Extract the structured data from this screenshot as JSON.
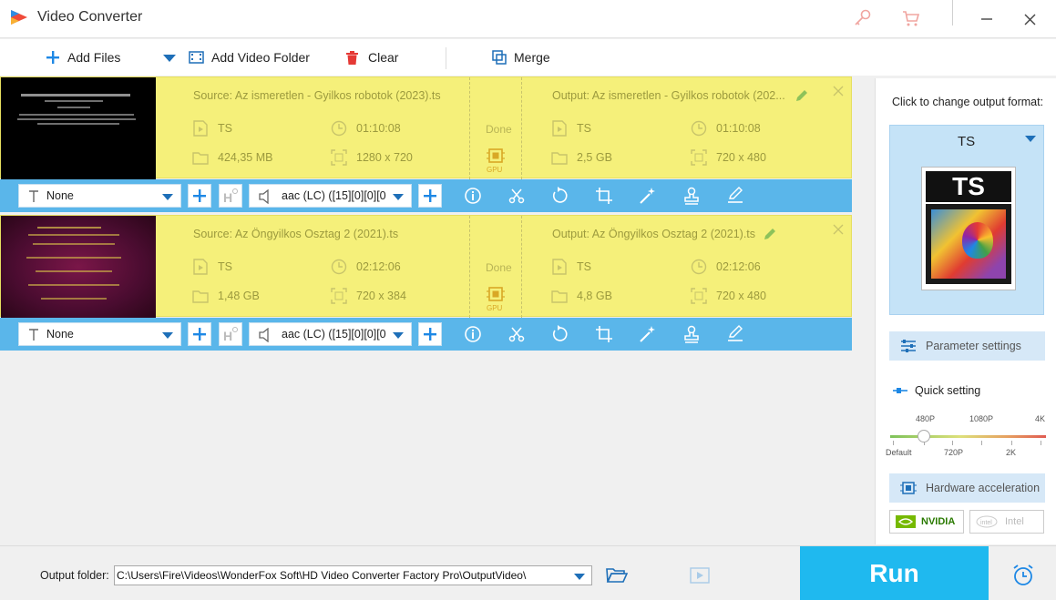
{
  "app": {
    "title": "Video Converter"
  },
  "toolbar": {
    "add_files": "Add Files",
    "add_video_folder": "Add Video Folder",
    "clear": "Clear",
    "merge": "Merge"
  },
  "items": [
    {
      "source": "Source: Az ismeretlen - Gyilkos robotok (2023).ts",
      "output": "Output: Az ismeretlen - Gyilkos robotok (202...",
      "src_format": "TS",
      "src_duration": "01:10:08",
      "src_size": "424,35 MB",
      "src_resolution": "1280 x 720",
      "status": "Done",
      "gpu": "GPU",
      "out_format": "TS",
      "out_duration": "01:10:08",
      "out_size": "2,5 GB",
      "out_resolution": "720 x 480",
      "subtitle": "None",
      "audio": "aac (LC) ([15][0][0][0"
    },
    {
      "source": "Source: Az Öngyilkos Osztag 2 (2021).ts",
      "output": "Output: Az Öngyilkos Osztag 2 (2021).ts",
      "src_format": "TS",
      "src_duration": "02:12:06",
      "src_size": "1,48 GB",
      "src_resolution": "720 x 384",
      "status": "Done",
      "gpu": "GPU",
      "out_format": "TS",
      "out_duration": "02:12:06",
      "out_size": "4,8 GB",
      "out_resolution": "720 x 480",
      "subtitle": "None",
      "audio": "aac (LC) ([15][0][0][0"
    }
  ],
  "panel": {
    "caption": "Click to change output format:",
    "format": "TS",
    "format_badge": "TS",
    "parameter_settings": "Parameter settings",
    "quick_setting": "Quick setting",
    "slider_top": [
      "480P",
      "1080P",
      "4K"
    ],
    "slider_bottom": [
      "Default",
      "720P",
      "2K"
    ],
    "hardware_acceleration": "Hardware acceleration",
    "nvidia": "NVIDIA",
    "intel": "Intel"
  },
  "bottom": {
    "output_folder_label": "Output folder:",
    "output_path": "C:\\Users\\Fire\\Videos\\WonderFox Soft\\HD Video Converter Factory Pro\\OutputVideo\\",
    "run": "Run"
  },
  "colors": {
    "accent": "#1fb9ef",
    "bar": "#5ab6ea",
    "item_bg": "#f5f07a"
  }
}
